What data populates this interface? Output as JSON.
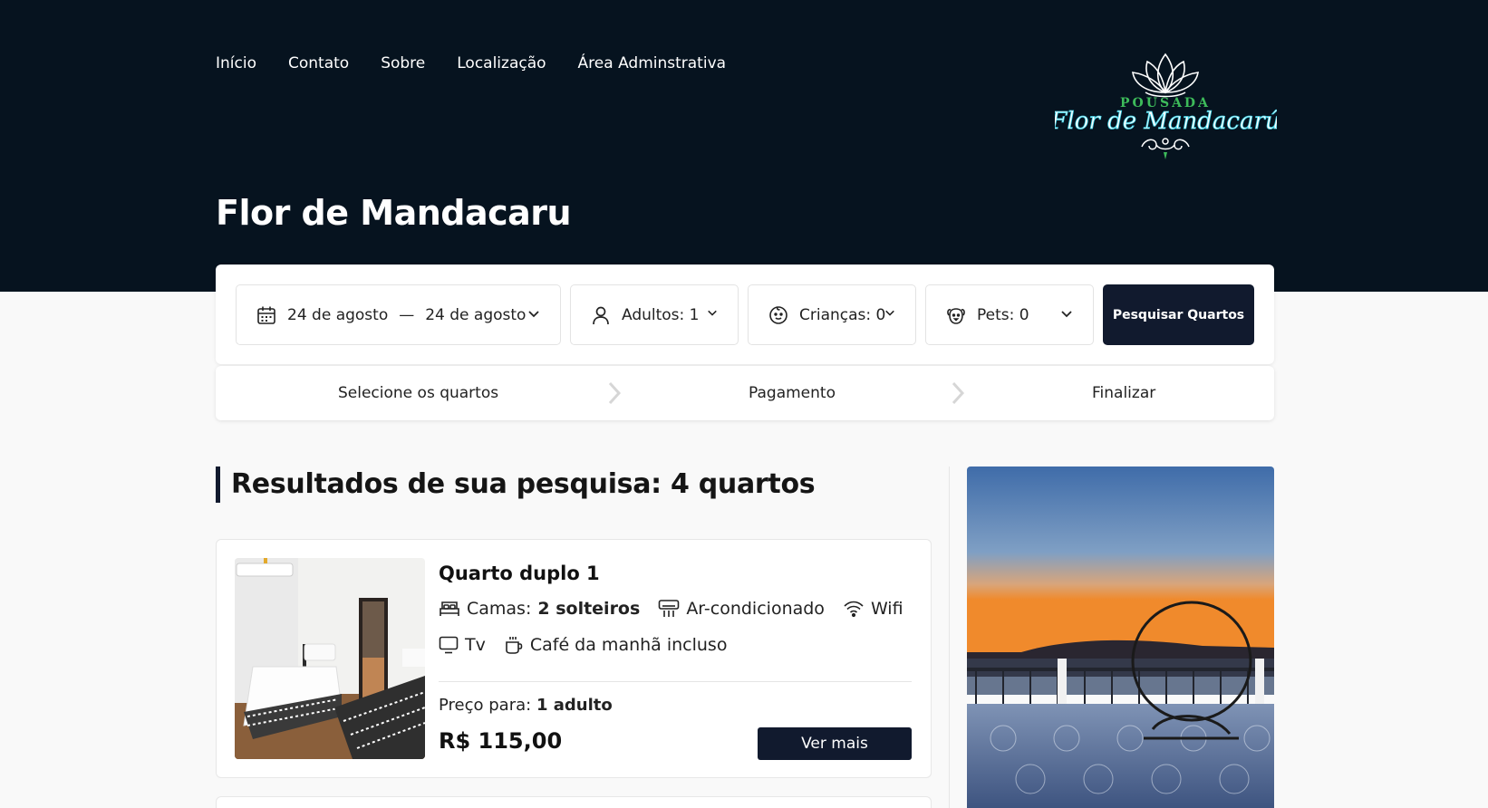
{
  "nav": {
    "items": [
      "Início",
      "Contato",
      "Sobre",
      "Localização",
      "Área Adminstrativa"
    ]
  },
  "logo": {
    "line1": "POUSADA",
    "line2": "Flor de Mandacarú"
  },
  "page_title": "Flor de Mandacaru",
  "search": {
    "date_from": "24 de agosto",
    "date_sep": "—",
    "date_to": "24 de agosto",
    "adults": "Adultos: 1",
    "children": "Crianças: 0",
    "pets": "Pets: 0",
    "button": "Pesquisar Quartos"
  },
  "steps": [
    "Selecione os quartos",
    "Pagamento",
    "Finalizar"
  ],
  "results_title": "Resultados de sua pesquisa: 4 quartos",
  "room": {
    "name": "Quarto duplo 1",
    "beds_label": "Camas:",
    "beds_value": "2 solteiros",
    "amenities": [
      "Ar-condicionado",
      "Wifi",
      "Tv",
      "Café da manhã incluso"
    ],
    "price_for_label": "Preço para:",
    "price_for_value": "1 adulto",
    "price": "R$ 115,00",
    "button": "Ver mais"
  },
  "colors": {
    "header_bg": "#06131f",
    "button_bg": "#111a2e",
    "logo_teal": "#3fd3e8",
    "logo_green": "#3dbb5a"
  }
}
